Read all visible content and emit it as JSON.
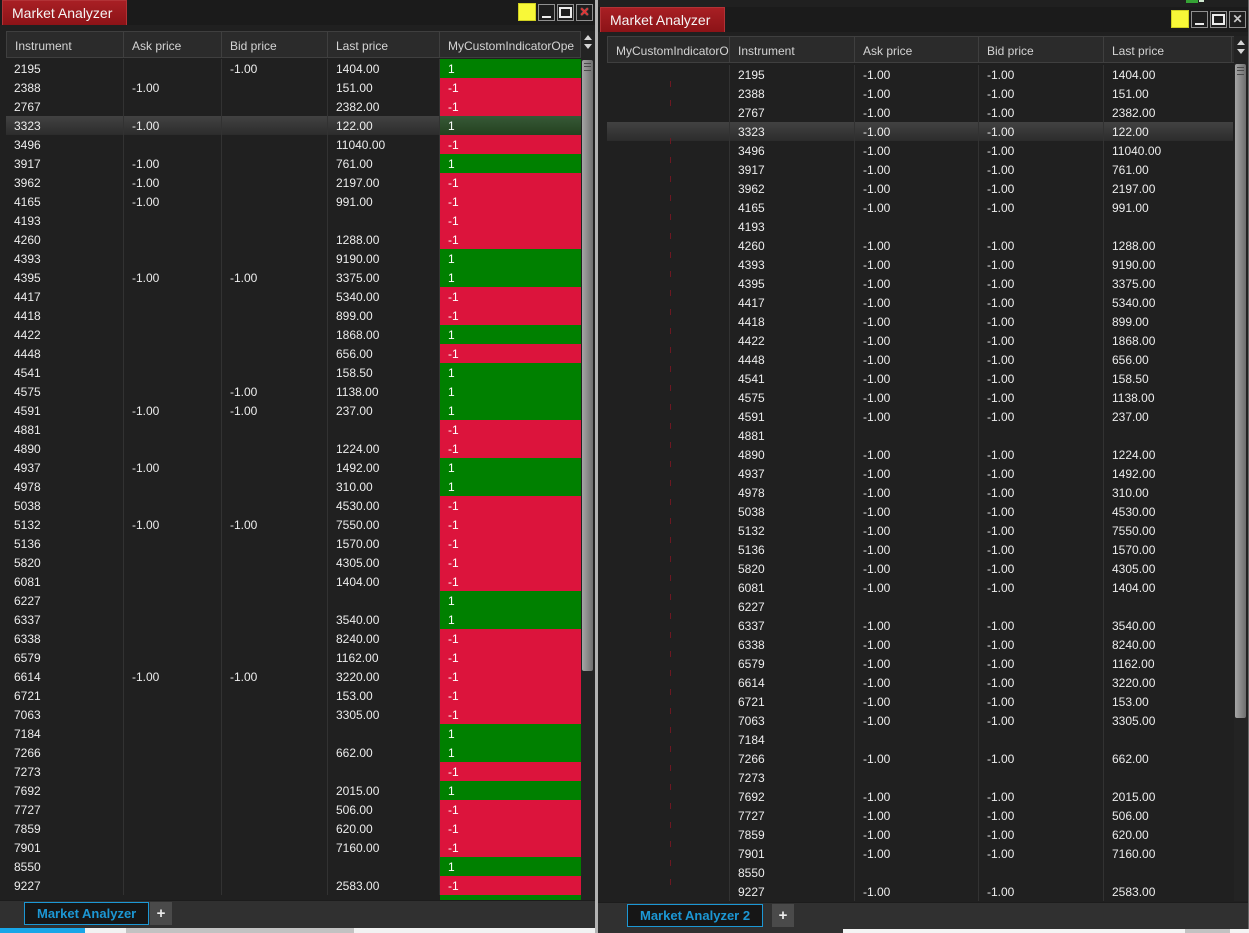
{
  "colors": {
    "indicator_green": "#008000",
    "indicator_red": "#DC143C",
    "accent_blue": "#1C97D4",
    "title_red": "#9B1B20",
    "sim_data_yellow": "#F8F838"
  },
  "icons": {
    "close": "✕",
    "minimize": "minimize-dash",
    "maximize": "maximize-box",
    "sim_indicator": "yellow-square",
    "scroll_up": "triangle-up",
    "scroll_down": "triangle-down"
  },
  "windows": [
    {
      "title": "Market Analyzer",
      "tab_label": "Market Analyzer",
      "add_tab_label": "+",
      "columns": [
        "Instrument",
        "Ask price",
        "Bid price",
        "Last price",
        "MyCustomIndicatorOpe"
      ],
      "rows": [
        {
          "instrument": "2195",
          "ask": "",
          "bid": "-1.00",
          "last": "1404.00",
          "indicator": "1"
        },
        {
          "instrument": "2388",
          "ask": "-1.00",
          "bid": "",
          "last": "151.00",
          "indicator": "-1"
        },
        {
          "instrument": "2767",
          "ask": "",
          "bid": "",
          "last": "2382.00",
          "indicator": "-1"
        },
        {
          "instrument": "3323",
          "ask": "-1.00",
          "bid": "",
          "last": "122.00",
          "indicator": "1",
          "selected": true
        },
        {
          "instrument": "3496",
          "ask": "",
          "bid": "",
          "last": "11040.00",
          "indicator": "-1"
        },
        {
          "instrument": "3917",
          "ask": "-1.00",
          "bid": "",
          "last": "761.00",
          "indicator": "1"
        },
        {
          "instrument": "3962",
          "ask": "-1.00",
          "bid": "",
          "last": "2197.00",
          "indicator": "-1"
        },
        {
          "instrument": "4165",
          "ask": "-1.00",
          "bid": "",
          "last": "991.00",
          "indicator": "-1"
        },
        {
          "instrument": "4193",
          "ask": "",
          "bid": "",
          "last": "",
          "indicator": "-1"
        },
        {
          "instrument": "4260",
          "ask": "",
          "bid": "",
          "last": "1288.00",
          "indicator": "-1"
        },
        {
          "instrument": "4393",
          "ask": "",
          "bid": "",
          "last": "9190.00",
          "indicator": "1"
        },
        {
          "instrument": "4395",
          "ask": "-1.00",
          "bid": "-1.00",
          "last": "3375.00",
          "indicator": "1"
        },
        {
          "instrument": "4417",
          "ask": "",
          "bid": "",
          "last": "5340.00",
          "indicator": "-1"
        },
        {
          "instrument": "4418",
          "ask": "",
          "bid": "",
          "last": "899.00",
          "indicator": "-1"
        },
        {
          "instrument": "4422",
          "ask": "",
          "bid": "",
          "last": "1868.00",
          "indicator": "1"
        },
        {
          "instrument": "4448",
          "ask": "",
          "bid": "",
          "last": "656.00",
          "indicator": "-1"
        },
        {
          "instrument": "4541",
          "ask": "",
          "bid": "",
          "last": "158.50",
          "indicator": "1"
        },
        {
          "instrument": "4575",
          "ask": "",
          "bid": "-1.00",
          "last": "1138.00",
          "indicator": "1"
        },
        {
          "instrument": "4591",
          "ask": "-1.00",
          "bid": "-1.00",
          "last": "237.00",
          "indicator": "1"
        },
        {
          "instrument": "4881",
          "ask": "",
          "bid": "",
          "last": "",
          "indicator": "-1"
        },
        {
          "instrument": "4890",
          "ask": "",
          "bid": "",
          "last": "1224.00",
          "indicator": "-1"
        },
        {
          "instrument": "4937",
          "ask": "-1.00",
          "bid": "",
          "last": "1492.00",
          "indicator": "1"
        },
        {
          "instrument": "4978",
          "ask": "",
          "bid": "",
          "last": "310.00",
          "indicator": "1"
        },
        {
          "instrument": "5038",
          "ask": "",
          "bid": "",
          "last": "4530.00",
          "indicator": "-1"
        },
        {
          "instrument": "5132",
          "ask": "-1.00",
          "bid": "-1.00",
          "last": "7550.00",
          "indicator": "-1"
        },
        {
          "instrument": "5136",
          "ask": "",
          "bid": "",
          "last": "1570.00",
          "indicator": "-1"
        },
        {
          "instrument": "5820",
          "ask": "",
          "bid": "",
          "last": "4305.00",
          "indicator": "-1"
        },
        {
          "instrument": "6081",
          "ask": "",
          "bid": "",
          "last": "1404.00",
          "indicator": "-1"
        },
        {
          "instrument": "6227",
          "ask": "",
          "bid": "",
          "last": "",
          "indicator": "1"
        },
        {
          "instrument": "6337",
          "ask": "",
          "bid": "",
          "last": "3540.00",
          "indicator": "1"
        },
        {
          "instrument": "6338",
          "ask": "",
          "bid": "",
          "last": "8240.00",
          "indicator": "-1"
        },
        {
          "instrument": "6579",
          "ask": "",
          "bid": "",
          "last": "1162.00",
          "indicator": "-1"
        },
        {
          "instrument": "6614",
          "ask": "-1.00",
          "bid": "-1.00",
          "last": "3220.00",
          "indicator": "-1"
        },
        {
          "instrument": "6721",
          "ask": "",
          "bid": "",
          "last": "153.00",
          "indicator": "-1"
        },
        {
          "instrument": "7063",
          "ask": "",
          "bid": "",
          "last": "3305.00",
          "indicator": "-1"
        },
        {
          "instrument": "7184",
          "ask": "",
          "bid": "",
          "last": "",
          "indicator": "1"
        },
        {
          "instrument": "7266",
          "ask": "",
          "bid": "",
          "last": "662.00",
          "indicator": "1"
        },
        {
          "instrument": "7273",
          "ask": "",
          "bid": "",
          "last": "",
          "indicator": "-1"
        },
        {
          "instrument": "7692",
          "ask": "",
          "bid": "",
          "last": "2015.00",
          "indicator": "1"
        },
        {
          "instrument": "7727",
          "ask": "",
          "bid": "",
          "last": "506.00",
          "indicator": "-1"
        },
        {
          "instrument": "7859",
          "ask": "",
          "bid": "",
          "last": "620.00",
          "indicator": "-1"
        },
        {
          "instrument": "7901",
          "ask": "",
          "bid": "",
          "last": "7160.00",
          "indicator": "-1"
        },
        {
          "instrument": "8550",
          "ask": "",
          "bid": "",
          "last": "",
          "indicator": "1"
        },
        {
          "instrument": "9227",
          "ask": "",
          "bid": "",
          "last": "2583.00",
          "indicator": "-1"
        }
      ]
    },
    {
      "title": "Market Analyzer",
      "tab_label": "Market Analyzer 2",
      "add_tab_label": "+",
      "columns": [
        "MyCustomIndicatorO",
        "Instrument",
        "Ask price",
        "Bid price",
        "Last price"
      ],
      "rows": [
        {
          "indicator": "",
          "instrument": "2195",
          "ask": "-1.00",
          "bid": "-1.00",
          "last": "1404.00"
        },
        {
          "indicator": "",
          "instrument": "2388",
          "ask": "-1.00",
          "bid": "-1.00",
          "last": "151.00"
        },
        {
          "indicator": "",
          "instrument": "2767",
          "ask": "-1.00",
          "bid": "-1.00",
          "last": "2382.00"
        },
        {
          "indicator": "",
          "instrument": "3323",
          "ask": "-1.00",
          "bid": "-1.00",
          "last": "122.00",
          "selected": true
        },
        {
          "indicator": "",
          "instrument": "3496",
          "ask": "-1.00",
          "bid": "-1.00",
          "last": "11040.00"
        },
        {
          "indicator": "",
          "instrument": "3917",
          "ask": "-1.00",
          "bid": "-1.00",
          "last": "761.00"
        },
        {
          "indicator": "",
          "instrument": "3962",
          "ask": "-1.00",
          "bid": "-1.00",
          "last": "2197.00"
        },
        {
          "indicator": "",
          "instrument": "4165",
          "ask": "-1.00",
          "bid": "-1.00",
          "last": "991.00"
        },
        {
          "indicator": "",
          "instrument": "4193",
          "ask": "",
          "bid": "",
          "last": ""
        },
        {
          "indicator": "",
          "instrument": "4260",
          "ask": "-1.00",
          "bid": "-1.00",
          "last": "1288.00"
        },
        {
          "indicator": "",
          "instrument": "4393",
          "ask": "-1.00",
          "bid": "-1.00",
          "last": "9190.00"
        },
        {
          "indicator": "",
          "instrument": "4395",
          "ask": "-1.00",
          "bid": "-1.00",
          "last": "3375.00"
        },
        {
          "indicator": "",
          "instrument": "4417",
          "ask": "-1.00",
          "bid": "-1.00",
          "last": "5340.00"
        },
        {
          "indicator": "",
          "instrument": "4418",
          "ask": "-1.00",
          "bid": "-1.00",
          "last": "899.00"
        },
        {
          "indicator": "",
          "instrument": "4422",
          "ask": "-1.00",
          "bid": "-1.00",
          "last": "1868.00"
        },
        {
          "indicator": "",
          "instrument": "4448",
          "ask": "-1.00",
          "bid": "-1.00",
          "last": "656.00"
        },
        {
          "indicator": "",
          "instrument": "4541",
          "ask": "-1.00",
          "bid": "-1.00",
          "last": "158.50"
        },
        {
          "indicator": "",
          "instrument": "4575",
          "ask": "-1.00",
          "bid": "-1.00",
          "last": "1138.00"
        },
        {
          "indicator": "",
          "instrument": "4591",
          "ask": "-1.00",
          "bid": "-1.00",
          "last": "237.00"
        },
        {
          "indicator": "",
          "instrument": "4881",
          "ask": "",
          "bid": "",
          "last": ""
        },
        {
          "indicator": "",
          "instrument": "4890",
          "ask": "-1.00",
          "bid": "-1.00",
          "last": "1224.00"
        },
        {
          "indicator": "",
          "instrument": "4937",
          "ask": "-1.00",
          "bid": "-1.00",
          "last": "1492.00"
        },
        {
          "indicator": "",
          "instrument": "4978",
          "ask": "-1.00",
          "bid": "-1.00",
          "last": "310.00"
        },
        {
          "indicator": "",
          "instrument": "5038",
          "ask": "-1.00",
          "bid": "-1.00",
          "last": "4530.00"
        },
        {
          "indicator": "",
          "instrument": "5132",
          "ask": "-1.00",
          "bid": "-1.00",
          "last": "7550.00"
        },
        {
          "indicator": "",
          "instrument": "5136",
          "ask": "-1.00",
          "bid": "-1.00",
          "last": "1570.00"
        },
        {
          "indicator": "",
          "instrument": "5820",
          "ask": "-1.00",
          "bid": "-1.00",
          "last": "4305.00"
        },
        {
          "indicator": "",
          "instrument": "6081",
          "ask": "-1.00",
          "bid": "-1.00",
          "last": "1404.00"
        },
        {
          "indicator": "",
          "instrument": "6227",
          "ask": "",
          "bid": "",
          "last": ""
        },
        {
          "indicator": "",
          "instrument": "6337",
          "ask": "-1.00",
          "bid": "-1.00",
          "last": "3540.00"
        },
        {
          "indicator": "",
          "instrument": "6338",
          "ask": "-1.00",
          "bid": "-1.00",
          "last": "8240.00"
        },
        {
          "indicator": "",
          "instrument": "6579",
          "ask": "-1.00",
          "bid": "-1.00",
          "last": "1162.00"
        },
        {
          "indicator": "",
          "instrument": "6614",
          "ask": "-1.00",
          "bid": "-1.00",
          "last": "3220.00"
        },
        {
          "indicator": "",
          "instrument": "6721",
          "ask": "-1.00",
          "bid": "-1.00",
          "last": "153.00"
        },
        {
          "indicator": "",
          "instrument": "7063",
          "ask": "-1.00",
          "bid": "-1.00",
          "last": "3305.00"
        },
        {
          "indicator": "",
          "instrument": "7184",
          "ask": "",
          "bid": "",
          "last": ""
        },
        {
          "indicator": "",
          "instrument": "7266",
          "ask": "-1.00",
          "bid": "-1.00",
          "last": "662.00"
        },
        {
          "indicator": "",
          "instrument": "7273",
          "ask": "",
          "bid": "",
          "last": ""
        },
        {
          "indicator": "",
          "instrument": "7692",
          "ask": "-1.00",
          "bid": "-1.00",
          "last": "2015.00"
        },
        {
          "indicator": "",
          "instrument": "7727",
          "ask": "-1.00",
          "bid": "-1.00",
          "last": "506.00"
        },
        {
          "indicator": "",
          "instrument": "7859",
          "ask": "-1.00",
          "bid": "-1.00",
          "last": "620.00"
        },
        {
          "indicator": "",
          "instrument": "7901",
          "ask": "-1.00",
          "bid": "-1.00",
          "last": "7160.00"
        },
        {
          "indicator": "",
          "instrument": "8550",
          "ask": "",
          "bid": "",
          "last": ""
        },
        {
          "indicator": "",
          "instrument": "9227",
          "ask": "-1.00",
          "bid": "-1.00",
          "last": "2583.00"
        }
      ]
    }
  ]
}
